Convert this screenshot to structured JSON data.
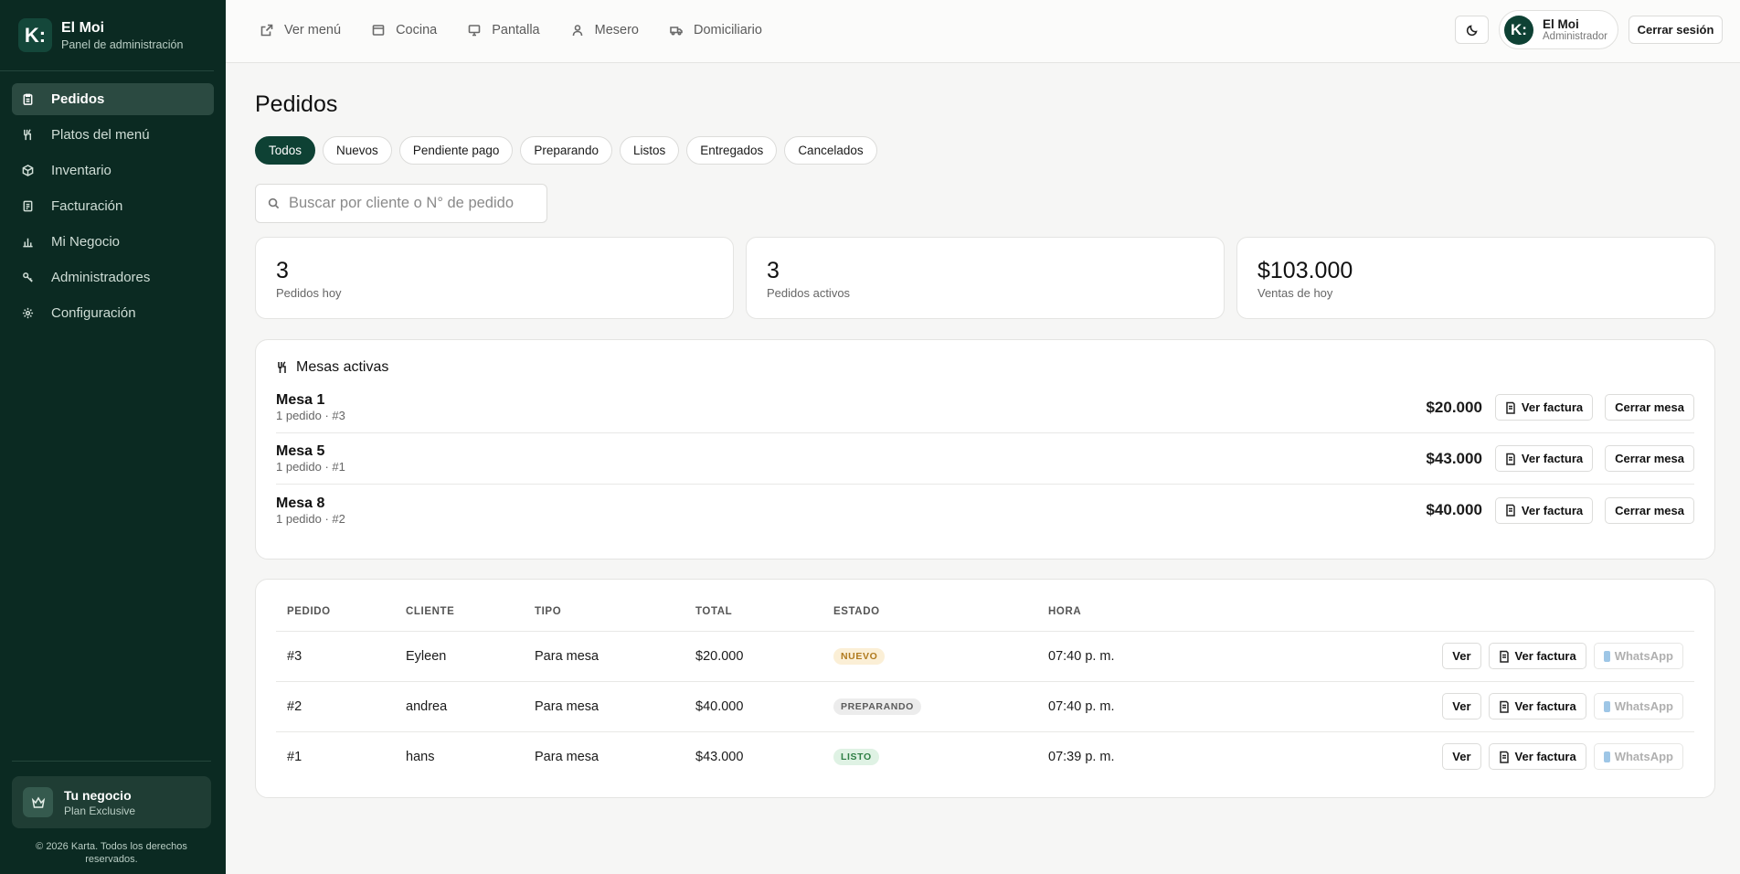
{
  "brand": {
    "logo": "K:",
    "name": "El Moi",
    "subtitle": "Panel de administración"
  },
  "sidebar": {
    "items": [
      {
        "label": "Pedidos",
        "icon": "clipboard-icon",
        "active": true
      },
      {
        "label": "Platos del menú",
        "icon": "utensils-icon",
        "active": false
      },
      {
        "label": "Inventario",
        "icon": "box-icon",
        "active": false
      },
      {
        "label": "Facturación",
        "icon": "receipt-icon",
        "active": false
      },
      {
        "label": "Mi Negocio",
        "icon": "bar-chart-icon",
        "active": false
      },
      {
        "label": "Administradores",
        "icon": "key-icon",
        "active": false
      },
      {
        "label": "Configuración",
        "icon": "gear-icon",
        "active": false
      }
    ],
    "plan": {
      "title": "Tu negocio",
      "subtitle": "Plan Exclusive",
      "icon": "crown-icon"
    },
    "copyright": "© 2026 Karta. Todos los derechos reservados."
  },
  "topbar": {
    "nav": [
      {
        "label": "Ver menú",
        "icon": "external-link-icon"
      },
      {
        "label": "Cocina",
        "icon": "stove-icon"
      },
      {
        "label": "Pantalla",
        "icon": "monitor-icon"
      },
      {
        "label": "Mesero",
        "icon": "person-icon"
      },
      {
        "label": "Domiciliario",
        "icon": "truck-icon"
      }
    ],
    "user": {
      "initial": "K:",
      "name": "El Moi",
      "role": "Administrador"
    },
    "logout_label": "Cerrar sesión"
  },
  "page": {
    "title": "Pedidos",
    "filters": [
      "Todos",
      "Nuevos",
      "Pendiente pago",
      "Preparando",
      "Listos",
      "Entregados",
      "Cancelados"
    ],
    "active_filter": "Todos",
    "search_placeholder": "Buscar por cliente o N° de pedido"
  },
  "stats": [
    {
      "value": "3",
      "label": "Pedidos hoy"
    },
    {
      "value": "3",
      "label": "Pedidos activos"
    },
    {
      "value": "$103.000",
      "label": "Ventas de hoy"
    }
  ],
  "mesas": {
    "title": "Mesas activas",
    "invoice_label": "Ver factura",
    "close_label": "Cerrar mesa",
    "rows": [
      {
        "name": "Mesa 1",
        "sub": "1 pedido · #3",
        "total": "$20.000"
      },
      {
        "name": "Mesa 5",
        "sub": "1 pedido · #1",
        "total": "$43.000"
      },
      {
        "name": "Mesa 8",
        "sub": "1 pedido · #2",
        "total": "$40.000"
      }
    ]
  },
  "orders": {
    "columns": [
      "PEDIDO",
      "CLIENTE",
      "TIPO",
      "TOTAL",
      "ESTADO",
      "HORA"
    ],
    "view_label": "Ver",
    "invoice_label": "Ver factura",
    "whatsapp_label": "WhatsApp",
    "rows": [
      {
        "id": "#3",
        "client": "Eyleen",
        "type": "Para mesa",
        "total": "$20.000",
        "status": "NUEVO",
        "status_bg": "#fbefd6",
        "status_color": "#b07a1e",
        "time": "07:40 p. m."
      },
      {
        "id": "#2",
        "client": "andrea",
        "type": "Para mesa",
        "total": "$40.000",
        "status": "PREPARANDO",
        "status_bg": "#ececec",
        "status_color": "#5b5b5b",
        "time": "07:40 p. m."
      },
      {
        "id": "#1",
        "client": "hans",
        "type": "Para mesa",
        "total": "$43.000",
        "status": "LISTO",
        "status_bg": "#dff2e4",
        "status_color": "#2f7f45",
        "time": "07:39 p. m."
      }
    ]
  },
  "colors": {
    "sidebar_bg": "#0b2a22",
    "accent": "#0e4134",
    "page_bg": "#f6f6f5"
  }
}
